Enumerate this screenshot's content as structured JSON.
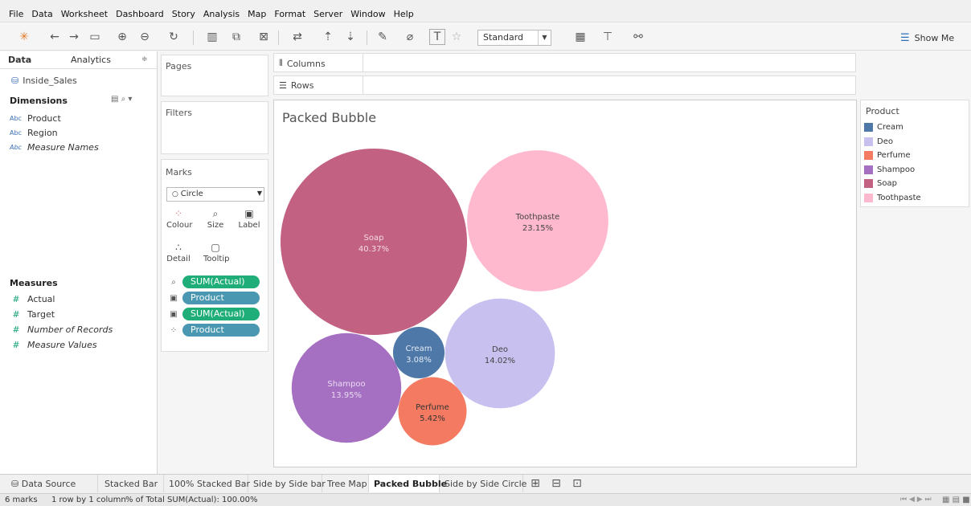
{
  "menu": [
    "File",
    "Data",
    "Worksheet",
    "Dashboard",
    "Story",
    "Analysis",
    "Map",
    "Format",
    "Server",
    "Window",
    "Help"
  ],
  "toolbar": {
    "standard": "Standard",
    "show_me": "Show Me"
  },
  "left": {
    "tab_data": "Data",
    "tab_analytics": "Analytics",
    "datasource": "Inside_Sales",
    "dimensions_title": "Dimensions",
    "dimensions": [
      {
        "type": "Abc",
        "name": "Product"
      },
      {
        "type": "Abc",
        "name": "Region"
      },
      {
        "type": "Abc",
        "name": "Measure Names"
      }
    ],
    "measures_title": "Measures",
    "measures": [
      {
        "name": "Actual"
      },
      {
        "name": "Target"
      },
      {
        "name": "Number of Records"
      },
      {
        "name": "Measure Values"
      }
    ]
  },
  "cards": {
    "pages": "Pages",
    "filters": "Filters",
    "marks": "Marks",
    "mark_type": "Circle",
    "buttons": [
      "Colour",
      "Size",
      "Label",
      "Detail",
      "Tooltip"
    ],
    "pills": [
      {
        "label": "SUM(Actual)",
        "color": "#1fae79"
      },
      {
        "label": "Product",
        "color": "#4997b1"
      },
      {
        "label": "SUM(Actual) Δ",
        "color": "#1fae79"
      },
      {
        "label": "Product",
        "color": "#4997b1"
      }
    ]
  },
  "shelves": {
    "columns": "Columns",
    "rows": "Rows"
  },
  "view": {
    "title": "Packed Bubble"
  },
  "chart_data": {
    "type": "packed-bubble",
    "measure": "SUM(Actual)",
    "unit": "% of total",
    "bubbles": [
      {
        "category": "Soap",
        "value": 40.37,
        "label": "40.37%",
        "color": "#c26181"
      },
      {
        "category": "Toothpaste",
        "value": 23.15,
        "label": "23.15%",
        "color": "#ffb9cf"
      },
      {
        "category": "Deo",
        "value": 14.02,
        "label": "14.02%",
        "color": "#c8c0ee"
      },
      {
        "category": "Shampoo",
        "value": 13.95,
        "label": "13.95%",
        "color": "#a56fc2"
      },
      {
        "category": "Perfume",
        "value": 5.42,
        "label": "5.42%",
        "color": "#f47b62"
      },
      {
        "category": "Cream",
        "value": 3.08,
        "label": "3.08%",
        "color": "#4e78a8"
      }
    ]
  },
  "legend": {
    "title": "Product",
    "items": [
      {
        "name": "Cream",
        "color": "#4e78a8"
      },
      {
        "name": "Deo",
        "color": "#c8c0ee"
      },
      {
        "name": "Perfume",
        "color": "#f47b62"
      },
      {
        "name": "Shampoo",
        "color": "#a56fc2"
      },
      {
        "name": "Soap",
        "color": "#c26181"
      },
      {
        "name": "Toothpaste",
        "color": "#ffb9cf"
      }
    ]
  },
  "sheet_tabs": {
    "data_source": "Data Source",
    "tabs": [
      "Stacked Bar",
      "100% Stacked Bar",
      "Side by Side bar",
      "Tree Map",
      "Packed Bubble",
      "Side by Side Circle"
    ],
    "active": "Packed Bubble"
  },
  "status": {
    "marks": "6 marks",
    "dims": "1 row by 1 column",
    "total": "% of Total SUM(Actual): 100.00%"
  }
}
